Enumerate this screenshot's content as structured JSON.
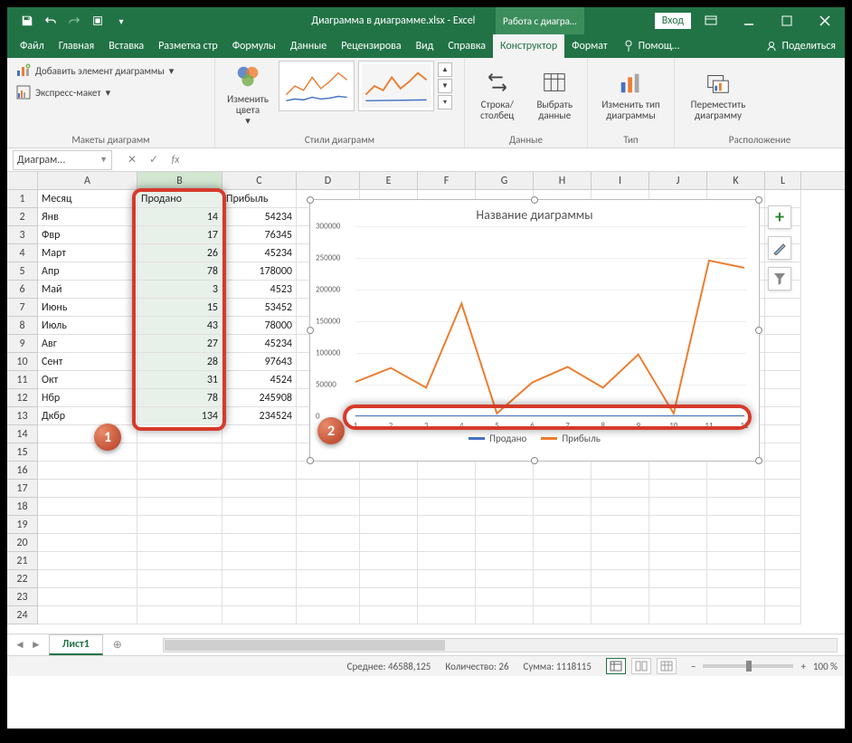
{
  "window": {
    "title": "Диаграмма в диаграмме.xlsx - Excel",
    "contextual_title": "Работа с диагра…",
    "signin": "Вход"
  },
  "ribbon_tabs": {
    "file": "Файл",
    "items": [
      "Главная",
      "Вставка",
      "Разметка стр",
      "Формулы",
      "Данные",
      "Рецензирова",
      "Вид",
      "Справка",
      "Конструктор",
      "Формат"
    ],
    "active": "Конструктор",
    "tell": "Помощ…",
    "share": "Поделиться"
  },
  "ribbon": {
    "layouts": {
      "btn_add": "Добавить элемент диаграммы",
      "btn_quick": "Экспресс-макет",
      "label": "Макеты диаграмм"
    },
    "colors": {
      "btn": "Изменить цвета"
    },
    "styles": {
      "label": "Стили диаграмм"
    },
    "data": {
      "swap": "Строка/\nстолбец",
      "select": "Выбрать\nданные",
      "label": "Данные"
    },
    "type": {
      "btn": "Изменить тип\nдиаграммы",
      "label": "Тип"
    },
    "loc": {
      "btn": "Переместить\nдиаграмму",
      "label": "Расположение"
    }
  },
  "formula_bar": {
    "name": "Диаграм...",
    "fx": "fx"
  },
  "columns": [
    "A",
    "B",
    "C",
    "D",
    "E",
    "F",
    "G",
    "H",
    "I",
    "J",
    "K",
    "L"
  ],
  "headers": {
    "month": "Месяц",
    "sold": "Продано",
    "profit": "Прибыль"
  },
  "rows": [
    {
      "n": 1
    },
    {
      "n": 2,
      "a": "Янв",
      "b": 14,
      "c": 54234
    },
    {
      "n": 3,
      "a": "Фвр",
      "b": 17,
      "c": 76345
    },
    {
      "n": 4,
      "a": "Март",
      "b": 26,
      "c": 45234
    },
    {
      "n": 5,
      "a": "Апр",
      "b": 78,
      "c": 178000
    },
    {
      "n": 6,
      "a": "Май",
      "b": 3,
      "c": 4523
    },
    {
      "n": 7,
      "a": "Июнь",
      "b": 15,
      "c": 53452
    },
    {
      "n": 8,
      "a": "Июль",
      "b": 43,
      "c": 78000
    },
    {
      "n": 9,
      "a": "Авг",
      "b": 27,
      "c": 45234
    },
    {
      "n": 10,
      "a": "Сент",
      "b": 28,
      "c": 97643
    },
    {
      "n": 11,
      "a": "Окт",
      "b": 31,
      "c": 4524
    },
    {
      "n": 12,
      "a": "Нбр",
      "b": 78,
      "c": 245908
    },
    {
      "n": 13,
      "a": "Дкбр",
      "b": 134,
      "c": 234524
    }
  ],
  "chart_data": {
    "type": "line",
    "title": "Название диаграммы",
    "x": [
      1,
      2,
      3,
      4,
      5,
      6,
      7,
      8,
      9,
      10,
      11,
      12
    ],
    "series": [
      {
        "name": "Продано",
        "color": "#4472c4",
        "values": [
          14,
          17,
          26,
          78,
          3,
          15,
          43,
          27,
          28,
          31,
          78,
          134
        ]
      },
      {
        "name": "Прибыль",
        "color": "#ed7d31",
        "values": [
          54234,
          76345,
          45234,
          178000,
          4523,
          53452,
          78000,
          45234,
          97643,
          4524,
          245908,
          234524
        ]
      }
    ],
    "ylim": [
      0,
      300000
    ],
    "yticks": [
      0,
      50000,
      100000,
      150000,
      200000,
      250000,
      300000
    ]
  },
  "legend": {
    "sold": "Продано",
    "profit": "Прибыль"
  },
  "sheet_tabs": {
    "active": "Лист1"
  },
  "statusbar": {
    "avg_l": "Среднее:",
    "avg": "46588,125",
    "count_l": "Количество:",
    "count": "26",
    "sum_l": "Сумма:",
    "sum": "1118115",
    "zoom": "100 %"
  },
  "colors": {
    "excel_green": "#217346",
    "series1": "#4472c4",
    "series2": "#ed7d31",
    "red": "#d63a2a"
  }
}
